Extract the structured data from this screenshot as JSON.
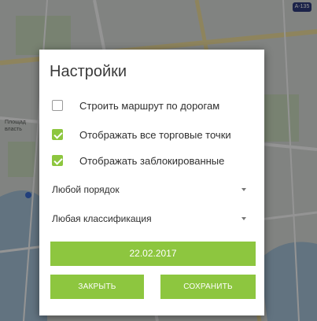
{
  "map": {
    "badge": "A-135",
    "labels": [
      "Площад",
      "власть"
    ]
  },
  "dialog": {
    "title": "Настройки",
    "options": [
      {
        "label": "Строить маршрут по дорогам",
        "checked": false
      },
      {
        "label": "Отображать все торговые точки",
        "checked": true
      },
      {
        "label": "Отображать заблокированные",
        "checked": true
      }
    ],
    "order_select": {
      "value": "Любой порядок"
    },
    "class_select": {
      "value": "Любая классификация"
    },
    "date_button": "22.02.2017",
    "close_button": "ЗАКРЫТЬ",
    "save_button": "СОХРАНИТЬ"
  },
  "colors": {
    "accent": "#8dc63f",
    "scrim": "rgba(0,0,0,0.42)"
  }
}
